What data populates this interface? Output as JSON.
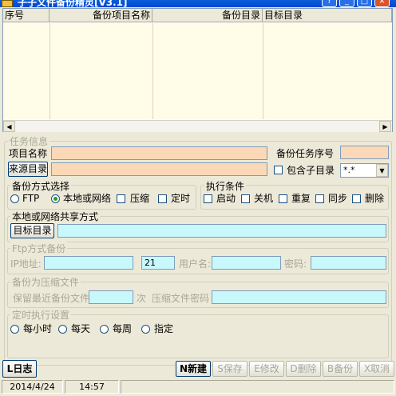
{
  "window": {
    "title": "子子文件备份精灵[V3.1]"
  },
  "table": {
    "columns": [
      "序号",
      "备份项目名称",
      "备份目录",
      "目标目录"
    ]
  },
  "task_info": {
    "legend": "任务信息",
    "project_name_label": "项目名称",
    "project_name_value": "",
    "task_no_label": "备份任务序号",
    "task_no_value": "",
    "source_dir_button": "来源目录",
    "source_dir_value": "",
    "include_subdirs_label": "包含子目录",
    "filter_value": "*.*"
  },
  "backup_mode": {
    "legend": "备份方式选择",
    "options": [
      "FTP",
      "本地或网络",
      "压缩",
      "定时"
    ]
  },
  "exec_conditions": {
    "legend": "执行条件",
    "options": [
      "启动",
      "关机",
      "重复",
      "同步",
      "删除"
    ]
  },
  "local_share": {
    "legend": "本地或网络共享方式",
    "target_dir_button": "目标目录",
    "target_dir_value": ""
  },
  "ftp": {
    "legend": "Ftp方式备份",
    "ip_label": "IP地址:",
    "ip_value": "",
    "port_value": "21",
    "user_label": "用户名:",
    "user_value": "",
    "password_label": "密码:",
    "password_value": ""
  },
  "compress": {
    "legend": "备份为压缩文件",
    "keep_label": "保留最近备份文件",
    "keep_value": "",
    "times_label": "次",
    "zip_password_label": "压缩文件密码",
    "zip_password_value": ""
  },
  "schedule": {
    "legend": "定时执行设置",
    "options": [
      "每小时",
      "每天",
      "每周",
      "指定"
    ]
  },
  "toolbar": {
    "log": "L日志",
    "new": "N新建",
    "save": "S保存",
    "modify": "E修改",
    "delete": "D删除",
    "backup": "B备份",
    "cancel": "X取消"
  },
  "status": {
    "date": "2014/4/24",
    "time": "14:57"
  }
}
